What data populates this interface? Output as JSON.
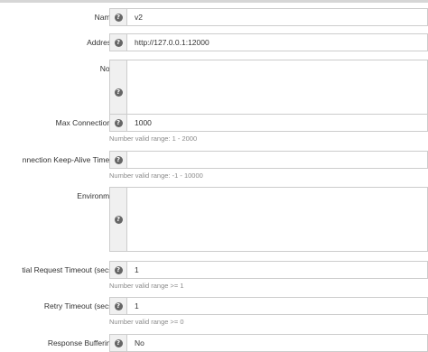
{
  "form": {
    "name": {
      "label": "Name *",
      "value": "v2"
    },
    "address": {
      "label": "Address *",
      "value": "http://127.0.0.1:12000"
    },
    "notes": {
      "label": "Notes",
      "value": ""
    },
    "max_connections": {
      "label": "Max Connections *",
      "value": "1000",
      "help": "Number valid range: 1 - 2000"
    },
    "keepalive": {
      "label": "nnection Keep-Alive Timeout",
      "value": "",
      "help": "Number valid range: -1 - 10000"
    },
    "environment": {
      "label": "Environment",
      "value": ""
    },
    "initial_request_timeout": {
      "label": "tial Request Timeout (secs) *",
      "value": "1",
      "help": "Number valid range >= 1"
    },
    "retry_timeout": {
      "label": "Retry Timeout (secs) *",
      "value": "1",
      "help": "Number valid range >= 0"
    },
    "response_buffering": {
      "label": "Response Buffering *",
      "value": "No"
    }
  },
  "icons": {
    "help": "question-circle-icon"
  },
  "colors": {
    "border": "#cccccc",
    "addon_bg": "#f0f0f0",
    "help_text": "#8a8a8a"
  }
}
